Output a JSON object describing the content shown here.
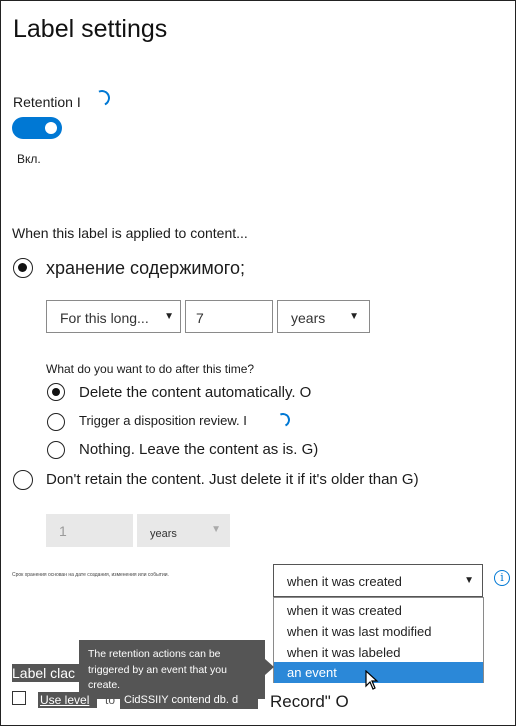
{
  "header": {
    "title": "Label settings"
  },
  "retention": {
    "label": "Retention I",
    "toggle_on": true,
    "toggle_state": "Вкл."
  },
  "applied": {
    "intro": "When this label is applied to content...",
    "retain_option": "хранение содержимого;",
    "period_select": "For this long...",
    "period_value": "7",
    "period_unit": "years",
    "after_question": "What do you want to do after this time?",
    "after_options": [
      {
        "label": "Delete the content automatically. O",
        "selected": true
      },
      {
        "label": "Trigger a disposition review. I",
        "selected": false
      },
      {
        "label": "Nothing. Leave the content as is. G)",
        "selected": false
      }
    ],
    "dont_retain_option": "Don't retain the content. Just delete it if it's older than G)",
    "delete_value": "1",
    "delete_unit": "years"
  },
  "based_on": {
    "hint": "Срок хранения основан на дате создания, изменения или событии.",
    "dropdown_value": "when it was created",
    "options": [
      {
        "label": "when it was created",
        "selected": false
      },
      {
        "label": "when it was last modified",
        "selected": false
      },
      {
        "label": "when it was labeled",
        "selected": false
      },
      {
        "label": "an event",
        "selected": true
      }
    ]
  },
  "tooltip": {
    "text": "The retention actions can be triggered by an event that you create."
  },
  "label_classification": {
    "heading": "Label clac",
    "checkbox_text": "Use level",
    "to_text": "to",
    "chip_text": "CidSSIIY contend db. d",
    "record_text": "Record\" O"
  },
  "icons": {
    "info": "info-icon",
    "spinner": "loading-spinner-icon",
    "caret": "chevron-down-icon",
    "cursor": "mouse-pointer-icon"
  },
  "colors": {
    "accent": "#0078d4",
    "selected_item": "#2b88d8",
    "tooltip_bg": "#555555"
  }
}
